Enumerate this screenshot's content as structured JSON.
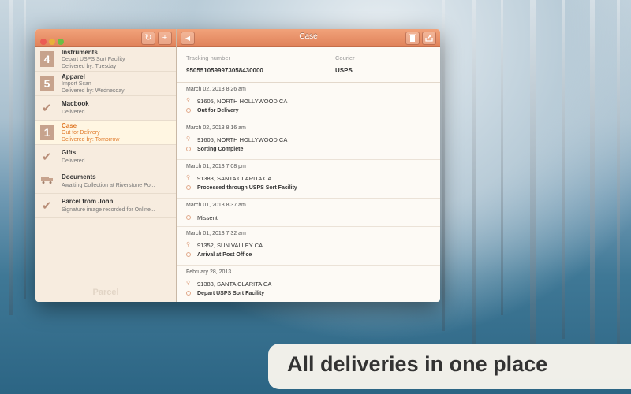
{
  "sidebar": {
    "items": [
      {
        "badge": "4",
        "name": "Instruments",
        "status": "Depart USPS Sort Facility",
        "delivery": "Delivered by: Tuesday"
      },
      {
        "badge": "5",
        "name": "Apparel",
        "status": "Import Scan",
        "delivery": "Delivered by: Wednesday"
      },
      {
        "name": "Macbook",
        "status": "Delivered"
      },
      {
        "badge": "1",
        "name": "Case",
        "status": "Out for Delivery",
        "delivery": "Delivered by: Tomorrow"
      },
      {
        "name": "Gifts",
        "status": "Delivered"
      },
      {
        "name": "Documents",
        "status": "Awaiting Collection at Riverstone Po..."
      },
      {
        "name": "Parcel from John",
        "status": "Signature image recorded for Online..."
      }
    ],
    "brand": "Parcel"
  },
  "detail": {
    "title": "Case",
    "tracking_label": "Tracking number",
    "tracking_value": "9505510599973058430000",
    "courier_label": "Courier",
    "courier_value": "USPS",
    "events": [
      {
        "date": "March 02, 2013 8:26 am",
        "location": "91605, NORTH HOLLYWOOD CA",
        "status": "Out for Delivery"
      },
      {
        "date": "March 02, 2013 8:16 am",
        "location": "91605, NORTH HOLLYWOOD CA",
        "status": "Sorting Complete"
      },
      {
        "date": "March 01, 2013 7:08 pm",
        "location": "91383, SANTA CLARITA CA",
        "status": "Processed through USPS Sort Facility"
      },
      {
        "date": "March 01, 2013 8:37 am",
        "status": "Missent"
      },
      {
        "date": "March 01, 2013 7:32 am",
        "location": "91352, SUN VALLEY CA",
        "status": "Arrival at Post Office"
      },
      {
        "date": "February 28, 2013",
        "location": "91383, SANTA CLARITA CA",
        "status": "Depart USPS Sort Facility"
      }
    ]
  },
  "banner": "All deliveries in one place",
  "colors": {
    "accent": "#e0825a",
    "selected_text": "#e07a2a"
  }
}
